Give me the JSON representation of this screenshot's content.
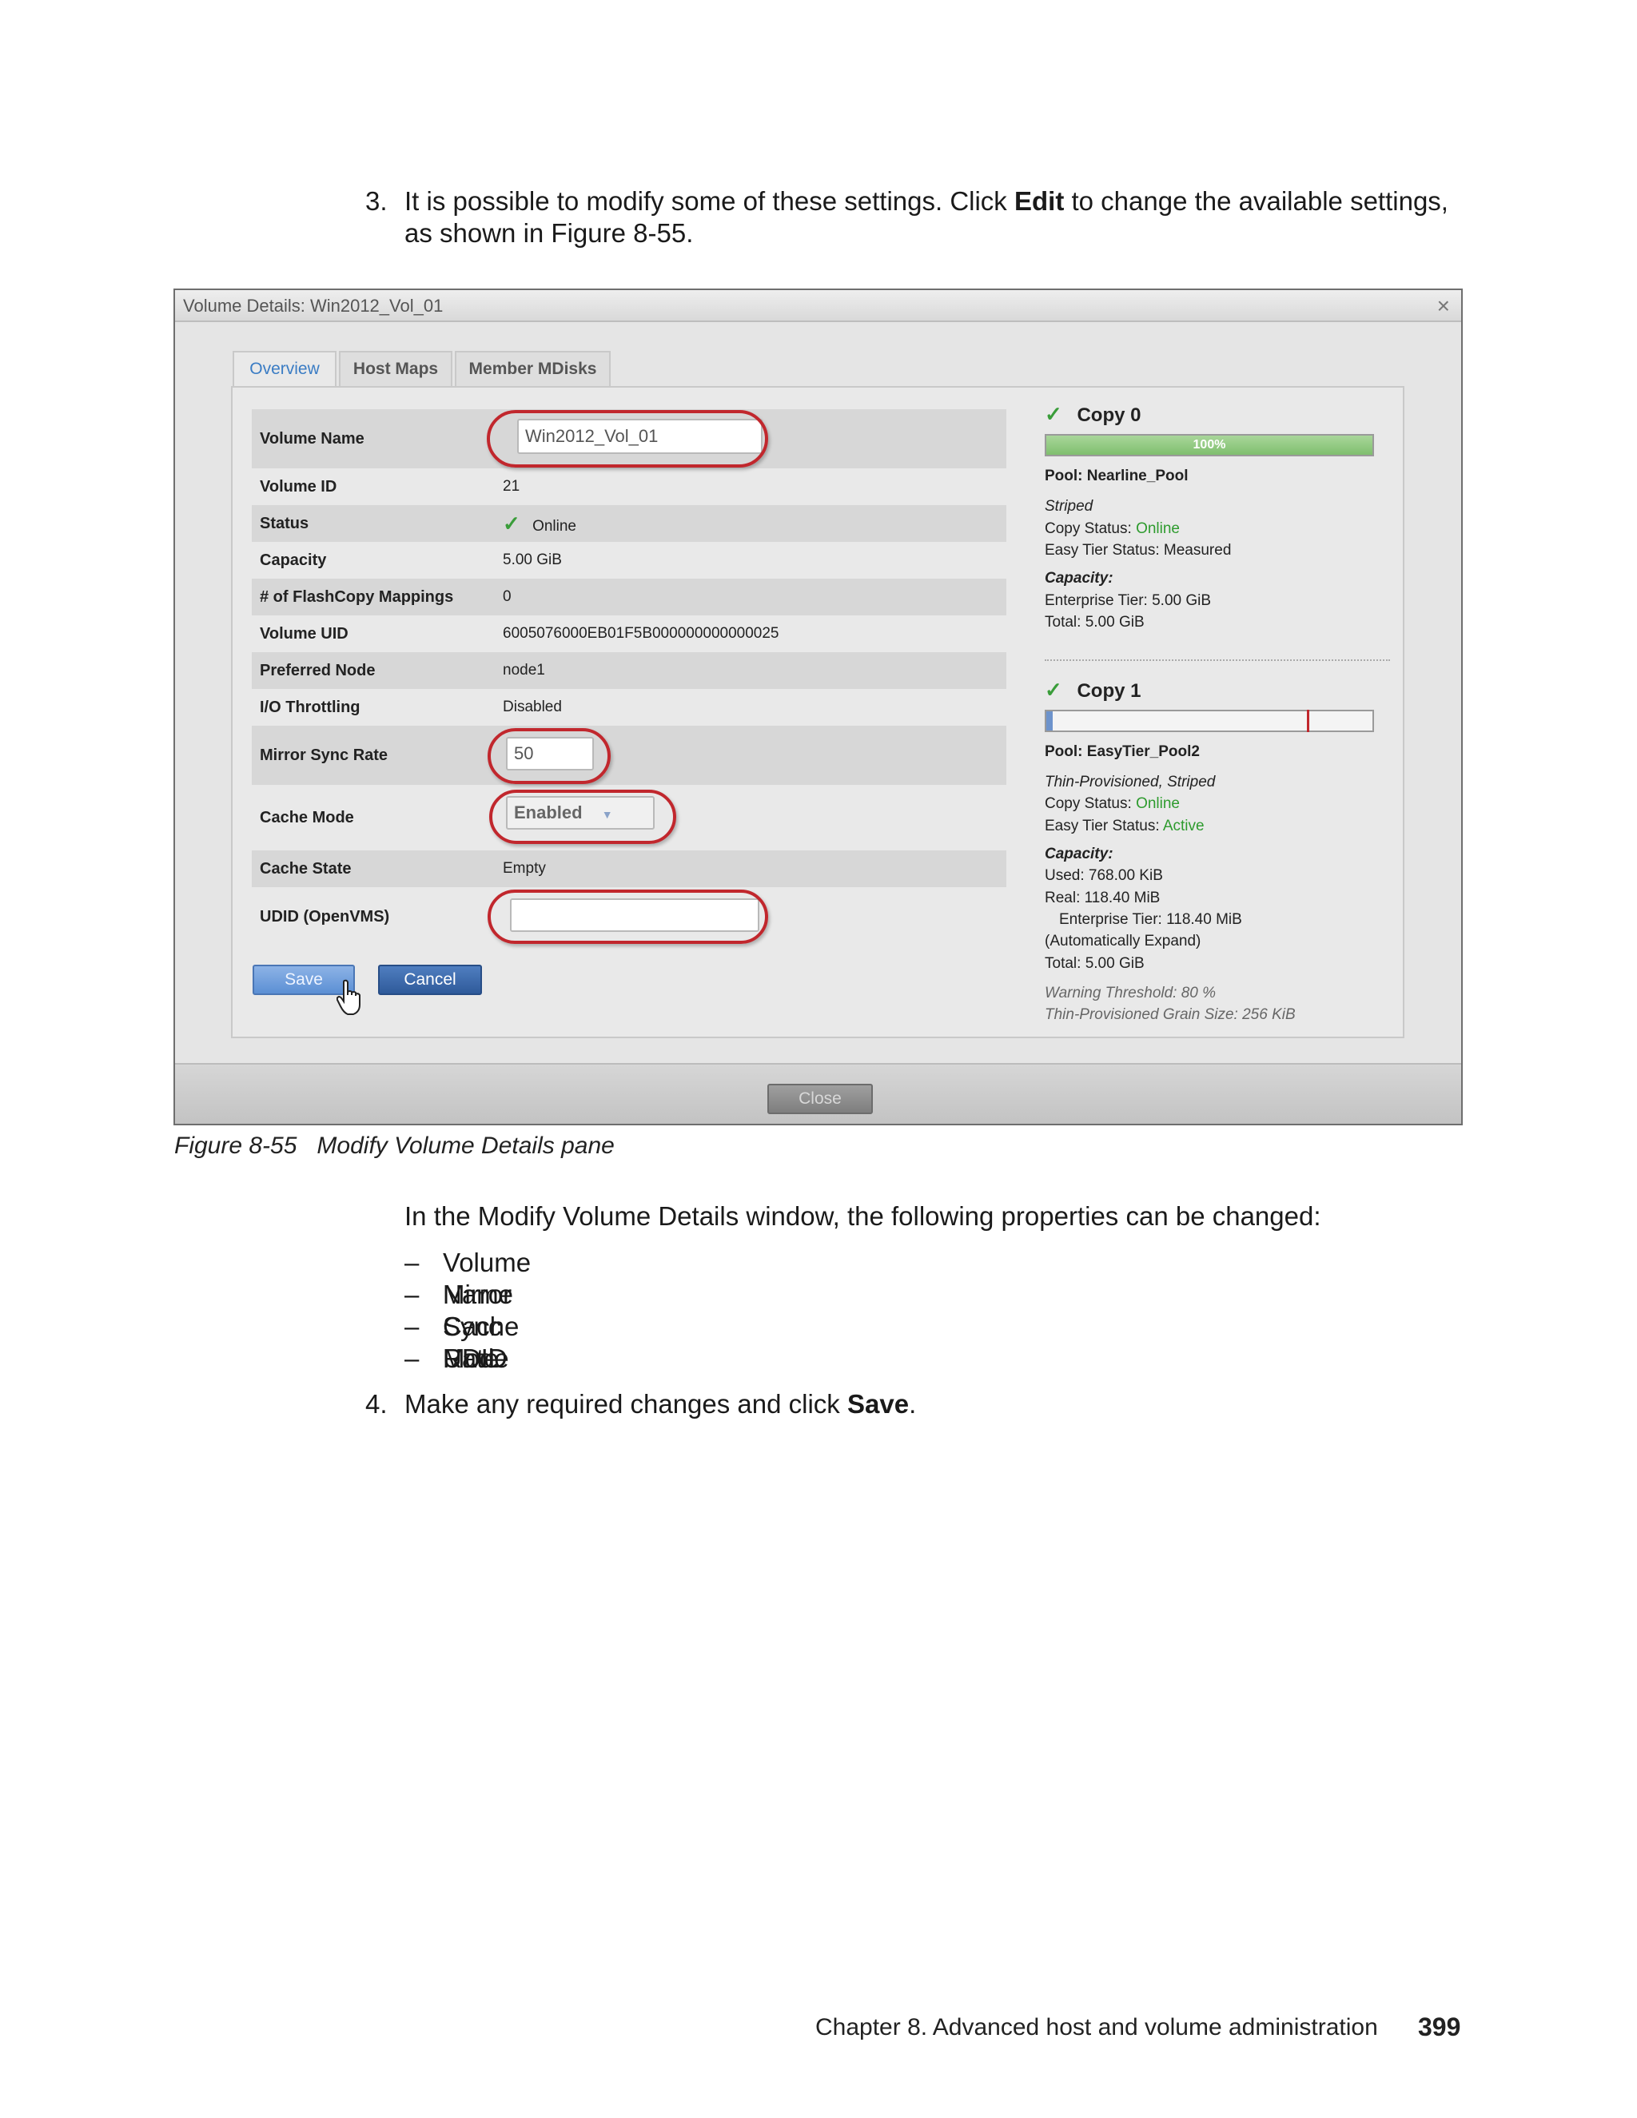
{
  "step3": {
    "number": "3.",
    "text_before": "It is possible to modify some of these settings. Click ",
    "bold": "Edit",
    "text_after": " to change the available settings,",
    "line2": "as shown in Figure 8-55."
  },
  "dialog": {
    "title": "Volume Details: Win2012_Vol_01",
    "close_glyph": "×",
    "tabs": [
      "Overview",
      "Host Maps",
      "Member MDisks"
    ],
    "fields": {
      "volume_name_label": "Volume Name",
      "volume_name_value": "Win2012_Vol_01",
      "volume_id_label": "Volume ID",
      "volume_id_value": "21",
      "status_label": "Status",
      "status_value": "Online",
      "capacity_label": "Capacity",
      "capacity_value": "5.00 GiB",
      "flashcopy_label": "# of FlashCopy Mappings",
      "flashcopy_value": "0",
      "uid_label": "Volume UID",
      "uid_value": "6005076000EB01F5B000000000000025",
      "preferred_node_label": "Preferred Node",
      "preferred_node_value": "node1",
      "io_label": "I/O Throttling",
      "io_value": "Disabled",
      "mirror_label": "Mirror Sync Rate",
      "mirror_value": "50",
      "cache_mode_label": "Cache Mode",
      "cache_mode_value": "Enabled",
      "cache_state_label": "Cache State",
      "cache_state_value": "Empty",
      "udid_label": "UDID (OpenVMS)",
      "udid_value": ""
    },
    "buttons": {
      "save": "Save",
      "cancel": "Cancel",
      "close": "Close"
    },
    "copy0": {
      "title": "Copy 0",
      "progress_label": "100%",
      "progress_fraction": 1.0,
      "pool": "Pool: Nearline_Pool",
      "layout": "Striped",
      "copy_status_label": "Copy Status: ",
      "copy_status_value": "Online",
      "easy_tier": "Easy Tier Status: Measured",
      "capacity_heading": "Capacity:",
      "enterprise_tier": "Enterprise Tier: 5.00 GiB",
      "total": "Total: 5.00 GiB"
    },
    "copy1": {
      "title": "Copy 1",
      "used_fraction": 0.02,
      "warning_fraction": 0.8,
      "pool": "Pool: EasyTier_Pool2",
      "layout": "Thin-Provisioned, Striped",
      "copy_status_label": "Copy Status: ",
      "copy_status_value": "Online",
      "easy_tier_label": "Easy Tier Status: ",
      "easy_tier_value": "Active",
      "capacity_heading": "Capacity:",
      "used": "Used: 768.00 KiB",
      "real": "Real: 118.40 MiB",
      "enterprise_tier": "Enterprise Tier: 118.40 MiB",
      "auto_expand": "(Automatically Expand)",
      "total": "Total: 5.00 GiB",
      "warning_threshold": "Warning Threshold: 80 %",
      "grain_size": "Thin-Provisioned Grain Size: 256 KiB"
    }
  },
  "caption": "Figure 8-55   Modify Volume Details pane",
  "intro": "In the Modify Volume Details window, the following properties can be changed:",
  "properties": [
    "Volume Name",
    "Mirror Sync Rate",
    "Cache Mode",
    "UDID"
  ],
  "dash": "–",
  "step4": {
    "number": "4.",
    "text_before": "Make any required changes and click ",
    "bold": "Save",
    "text_after": "."
  },
  "footer": {
    "chapter": "Chapter 8. Advanced host and volume administration",
    "page": "399"
  },
  "colors": {
    "highlight": "#c1272d",
    "online": "#2e9b2e",
    "tab_active": "#3a7cc4"
  }
}
